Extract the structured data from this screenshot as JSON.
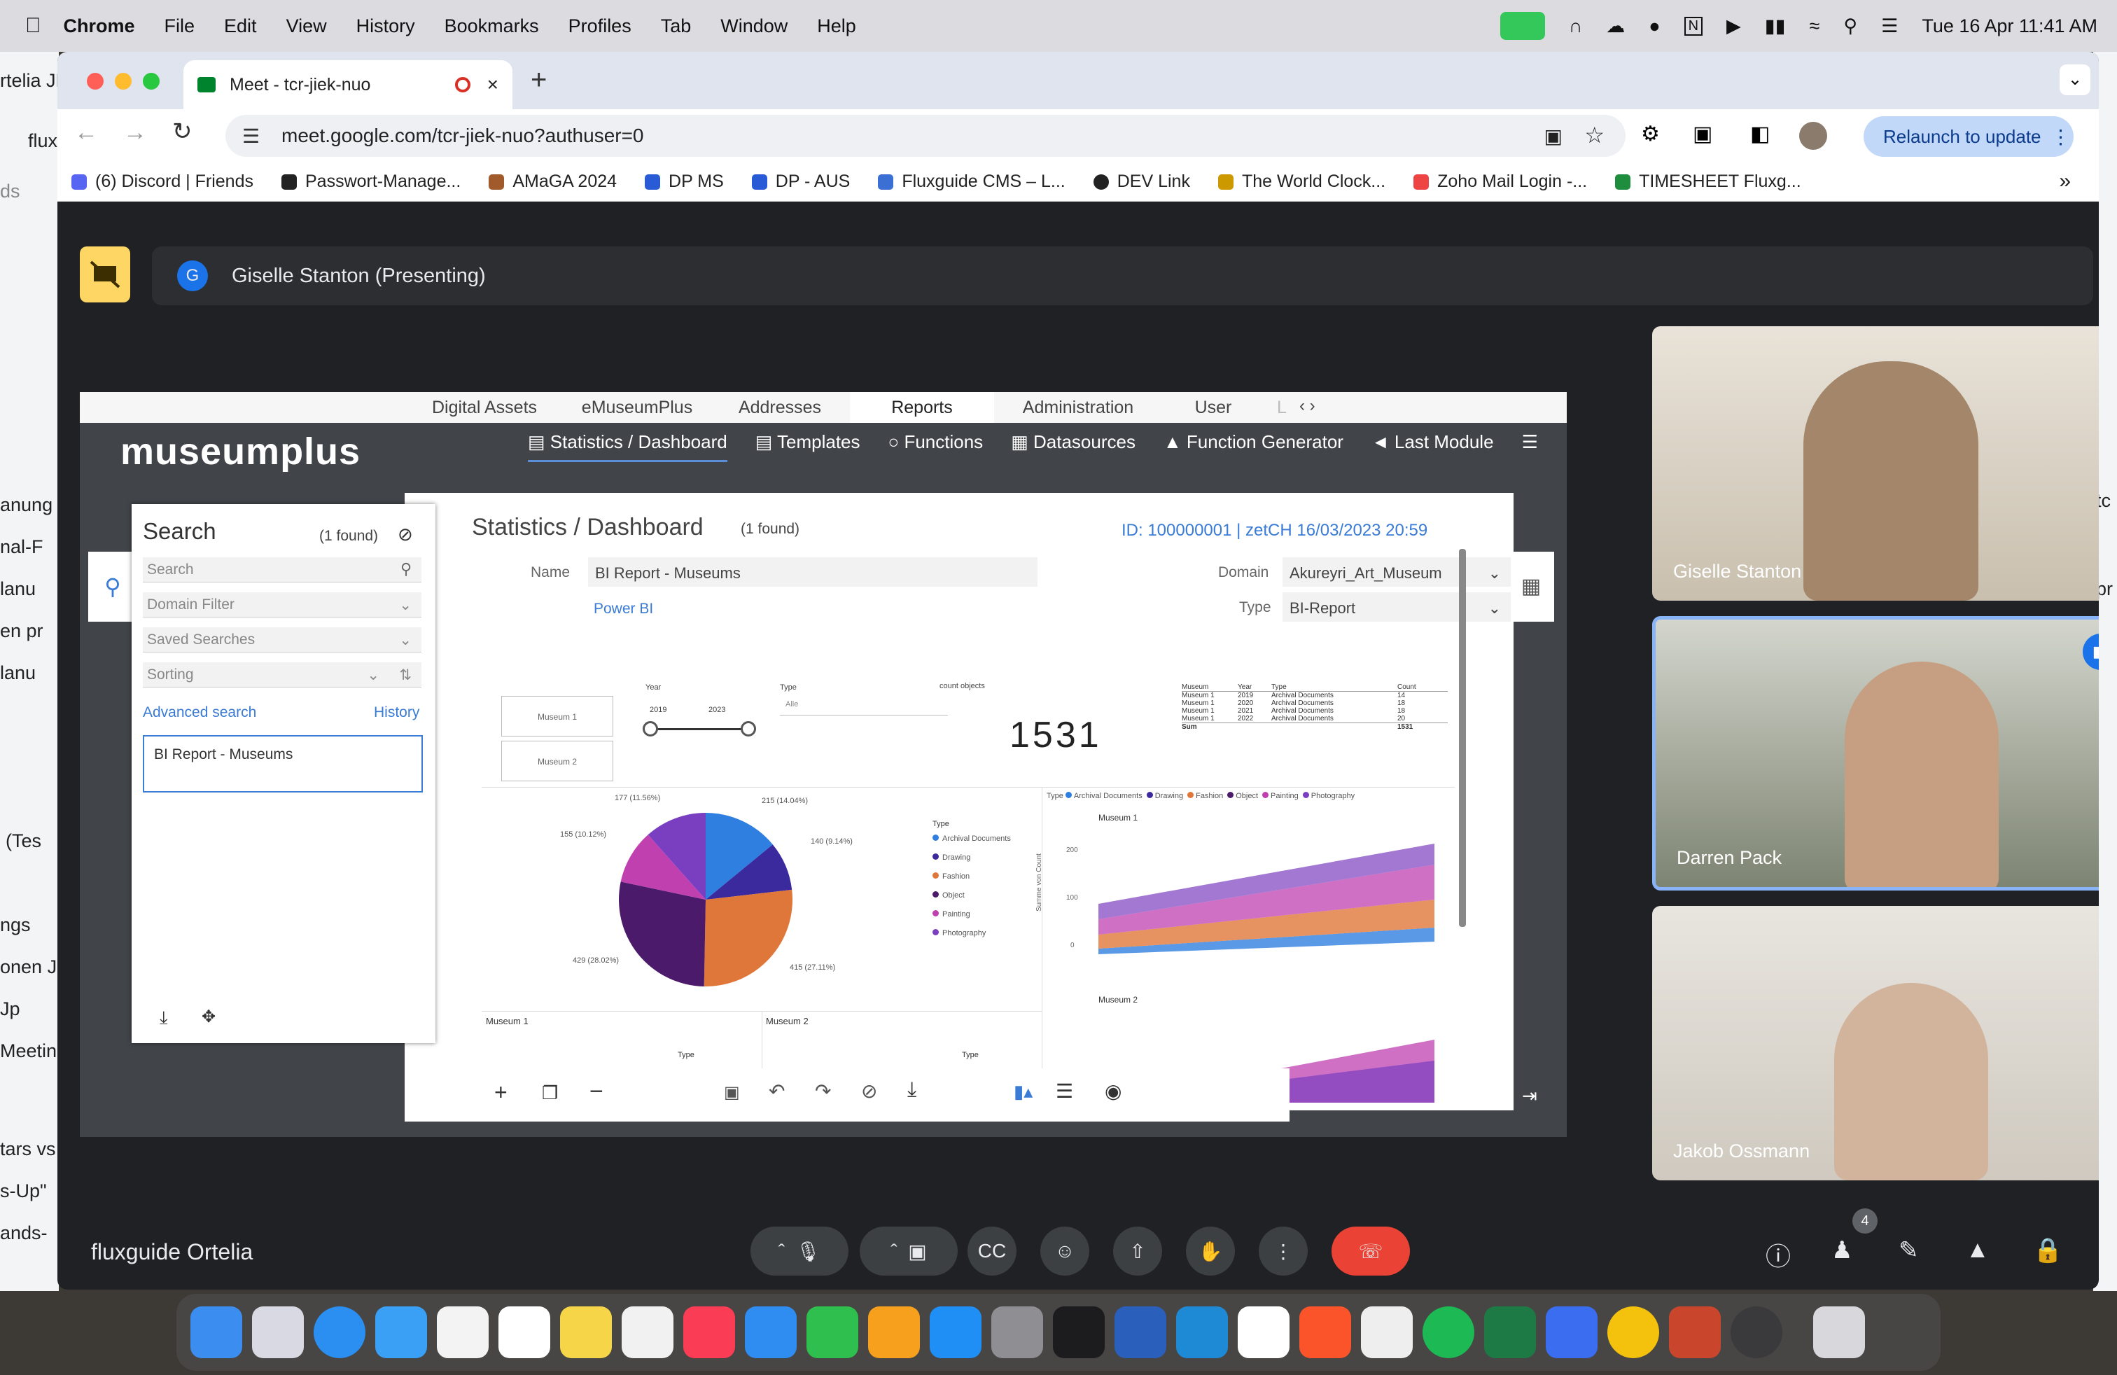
{
  "menubar": {
    "items": [
      "Chrome",
      "File",
      "Edit",
      "View",
      "History",
      "Bookmarks",
      "Profiles",
      "Tab",
      "Window",
      "Help"
    ],
    "datetime": "Tue 16 Apr  11:41 AM"
  },
  "background_window": {
    "fragments": [
      "rtelia JF",
      "flux",
      "ds",
      "anung",
      "nal-F",
      "lanu",
      "en pr",
      "lanu",
      "(Tes",
      "ngs",
      "onen J",
      "Jp",
      "Meetin",
      "tars vs",
      "s-Up\"",
      "ands-"
    ],
    "right_fragments": [
      "tc",
      "pr"
    ]
  },
  "browser": {
    "tab_title": "Meet - tcr-jiek-nuo",
    "url": "meet.google.com/tcr-jiek-nuo?authuser=0",
    "relaunch_label": "Relaunch to update",
    "bookmarks": [
      {
        "label": "(6) Discord | Friends",
        "color": "#5865f2"
      },
      {
        "label": "Passwort-Manage...",
        "color": "#222222"
      },
      {
        "label": "AMaGA 2024",
        "color": "#a05a2c"
      },
      {
        "label": "DP MS",
        "color": "#2a5bd7"
      },
      {
        "label": "DP - AUS",
        "color": "#2a5bd7"
      },
      {
        "label": "Fluxguide CMS – L...",
        "color": "#3b6fd4"
      },
      {
        "label": "DEV Link",
        "color": "#222222"
      },
      {
        "label": "The World Clock...",
        "color": "#cc9900"
      },
      {
        "label": "Zoho Mail Login -...",
        "color": "#e44"
      },
      {
        "label": "TIMESHEET Fluxg...",
        "color": "#1e8e3e"
      }
    ]
  },
  "meet": {
    "presenter": "Giselle Stanton (Presenting)",
    "presenter_initial": "G",
    "meeting_name": "fluxguide Ortelia",
    "people_count": "4",
    "participants": [
      {
        "name": "Giselle Stanton"
      },
      {
        "name": "Darren Pack"
      },
      {
        "name": "Jakob Ossmann"
      }
    ]
  },
  "museumplus": {
    "top_tabs": [
      "Digital Assets",
      "eMuseumPlus",
      "Addresses",
      "Reports",
      "Administration",
      "User",
      "L"
    ],
    "active_tab": "Reports",
    "logo": "museumplus",
    "nav": [
      "Statistics / Dashboard",
      "Templates",
      "Functions",
      "Datasources",
      "Function Generator",
      "Last Module"
    ],
    "search": {
      "title": "Search",
      "found": "(1 found)",
      "placeholder": "Search",
      "domain_filter": "Domain Filter",
      "saved_searches": "Saved Searches",
      "sorting": "Sorting",
      "advanced": "Advanced search",
      "history": "History",
      "result": "BI Report - Museums"
    },
    "dashboard": {
      "title": "Statistics / Dashboard",
      "found": "(1 found)",
      "id_line": "ID: 100000001 | zetCH 16/03/2023 20:59",
      "name_label": "Name",
      "name_value": "BI Report - Museums",
      "link": "Power BI",
      "domain_label": "Domain",
      "domain_value": "Akureyri_Art_Museum",
      "type_label": "Type",
      "type_value": "BI-Report",
      "big_count": "1531",
      "count_label": "count objects",
      "filter_labels": [
        "Year",
        "Type"
      ],
      "filter_years": [
        "2019",
        "2023"
      ],
      "filter_all": "Alle",
      "museum_boxes": [
        "Museum 1",
        "Museum 2"
      ],
      "table_header": [
        "Museum",
        "Year",
        "Type",
        "Count"
      ],
      "table_rows": [
        [
          "Museum 1",
          "2019",
          "Archival Documents",
          "14"
        ],
        [
          "Museum 1",
          "2020",
          "Archival Documents",
          "18"
        ],
        [
          "Museum 1",
          "2021",
          "Archival Documents",
          "18"
        ],
        [
          "Museum 1",
          "2022",
          "Archival Documents",
          "20"
        ]
      ],
      "table_sum": [
        "Sum",
        "1531"
      ],
      "legend_title": "Type",
      "legend": [
        {
          "label": "Archival Documents",
          "color": "#2f7fe0"
        },
        {
          "label": "Drawing",
          "color": "#3a2a9e"
        },
        {
          "label": "Fashion",
          "color": "#e0773a"
        },
        {
          "label": "Object",
          "color": "#4b1a6b"
        },
        {
          "label": "Painting",
          "color": "#c040b0"
        },
        {
          "label": "Photography",
          "color": "#7a3fc0"
        }
      ],
      "pie_labels": [
        "177 (11.56%)",
        "215 (14.04%)",
        "140 (9.14%)",
        "155 (10.12%)",
        "415 (27.11%)",
        "429 (28.02%)"
      ],
      "pie_values": [
        215,
        140,
        415,
        429,
        155,
        177
      ],
      "area_panel1": "Museum 1",
      "area_panel2": "Museum 2",
      "area_yticks": [
        "200",
        "100",
        "0"
      ],
      "area_ylabel": "Summe von Count",
      "bottom_labels": [
        "Museum 1",
        "Museum 2",
        "Type",
        "Type"
      ]
    }
  }
}
